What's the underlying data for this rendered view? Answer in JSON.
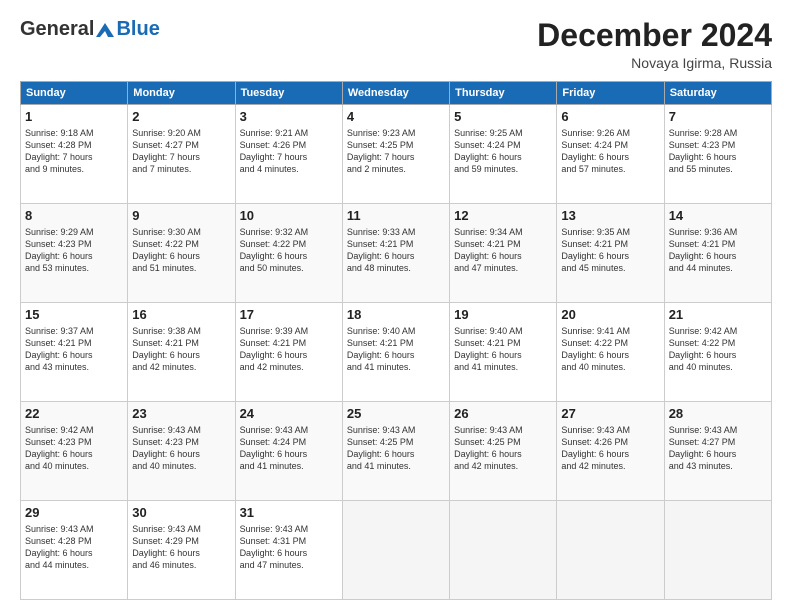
{
  "header": {
    "logo_general": "General",
    "logo_blue": "Blue",
    "month_title": "December 2024",
    "subtitle": "Novaya Igirma, Russia"
  },
  "days_of_week": [
    "Sunday",
    "Monday",
    "Tuesday",
    "Wednesday",
    "Thursday",
    "Friday",
    "Saturday"
  ],
  "weeks": [
    [
      {
        "day": "1",
        "info": "Sunrise: 9:18 AM\nSunset: 4:28 PM\nDaylight: 7 hours\nand 9 minutes."
      },
      {
        "day": "2",
        "info": "Sunrise: 9:20 AM\nSunset: 4:27 PM\nDaylight: 7 hours\nand 7 minutes."
      },
      {
        "day": "3",
        "info": "Sunrise: 9:21 AM\nSunset: 4:26 PM\nDaylight: 7 hours\nand 4 minutes."
      },
      {
        "day": "4",
        "info": "Sunrise: 9:23 AM\nSunset: 4:25 PM\nDaylight: 7 hours\nand 2 minutes."
      },
      {
        "day": "5",
        "info": "Sunrise: 9:25 AM\nSunset: 4:24 PM\nDaylight: 6 hours\nand 59 minutes."
      },
      {
        "day": "6",
        "info": "Sunrise: 9:26 AM\nSunset: 4:24 PM\nDaylight: 6 hours\nand 57 minutes."
      },
      {
        "day": "7",
        "info": "Sunrise: 9:28 AM\nSunset: 4:23 PM\nDaylight: 6 hours\nand 55 minutes."
      }
    ],
    [
      {
        "day": "8",
        "info": "Sunrise: 9:29 AM\nSunset: 4:23 PM\nDaylight: 6 hours\nand 53 minutes."
      },
      {
        "day": "9",
        "info": "Sunrise: 9:30 AM\nSunset: 4:22 PM\nDaylight: 6 hours\nand 51 minutes."
      },
      {
        "day": "10",
        "info": "Sunrise: 9:32 AM\nSunset: 4:22 PM\nDaylight: 6 hours\nand 50 minutes."
      },
      {
        "day": "11",
        "info": "Sunrise: 9:33 AM\nSunset: 4:21 PM\nDaylight: 6 hours\nand 48 minutes."
      },
      {
        "day": "12",
        "info": "Sunrise: 9:34 AM\nSunset: 4:21 PM\nDaylight: 6 hours\nand 47 minutes."
      },
      {
        "day": "13",
        "info": "Sunrise: 9:35 AM\nSunset: 4:21 PM\nDaylight: 6 hours\nand 45 minutes."
      },
      {
        "day": "14",
        "info": "Sunrise: 9:36 AM\nSunset: 4:21 PM\nDaylight: 6 hours\nand 44 minutes."
      }
    ],
    [
      {
        "day": "15",
        "info": "Sunrise: 9:37 AM\nSunset: 4:21 PM\nDaylight: 6 hours\nand 43 minutes."
      },
      {
        "day": "16",
        "info": "Sunrise: 9:38 AM\nSunset: 4:21 PM\nDaylight: 6 hours\nand 42 minutes."
      },
      {
        "day": "17",
        "info": "Sunrise: 9:39 AM\nSunset: 4:21 PM\nDaylight: 6 hours\nand 42 minutes."
      },
      {
        "day": "18",
        "info": "Sunrise: 9:40 AM\nSunset: 4:21 PM\nDaylight: 6 hours\nand 41 minutes."
      },
      {
        "day": "19",
        "info": "Sunrise: 9:40 AM\nSunset: 4:21 PM\nDaylight: 6 hours\nand 41 minutes."
      },
      {
        "day": "20",
        "info": "Sunrise: 9:41 AM\nSunset: 4:22 PM\nDaylight: 6 hours\nand 40 minutes."
      },
      {
        "day": "21",
        "info": "Sunrise: 9:42 AM\nSunset: 4:22 PM\nDaylight: 6 hours\nand 40 minutes."
      }
    ],
    [
      {
        "day": "22",
        "info": "Sunrise: 9:42 AM\nSunset: 4:23 PM\nDaylight: 6 hours\nand 40 minutes."
      },
      {
        "day": "23",
        "info": "Sunrise: 9:43 AM\nSunset: 4:23 PM\nDaylight: 6 hours\nand 40 minutes."
      },
      {
        "day": "24",
        "info": "Sunrise: 9:43 AM\nSunset: 4:24 PM\nDaylight: 6 hours\nand 41 minutes."
      },
      {
        "day": "25",
        "info": "Sunrise: 9:43 AM\nSunset: 4:25 PM\nDaylight: 6 hours\nand 41 minutes."
      },
      {
        "day": "26",
        "info": "Sunrise: 9:43 AM\nSunset: 4:25 PM\nDaylight: 6 hours\nand 42 minutes."
      },
      {
        "day": "27",
        "info": "Sunrise: 9:43 AM\nSunset: 4:26 PM\nDaylight: 6 hours\nand 42 minutes."
      },
      {
        "day": "28",
        "info": "Sunrise: 9:43 AM\nSunset: 4:27 PM\nDaylight: 6 hours\nand 43 minutes."
      }
    ],
    [
      {
        "day": "29",
        "info": "Sunrise: 9:43 AM\nSunset: 4:28 PM\nDaylight: 6 hours\nand 44 minutes."
      },
      {
        "day": "30",
        "info": "Sunrise: 9:43 AM\nSunset: 4:29 PM\nDaylight: 6 hours\nand 46 minutes."
      },
      {
        "day": "31",
        "info": "Sunrise: 9:43 AM\nSunset: 4:31 PM\nDaylight: 6 hours\nand 47 minutes."
      },
      {
        "day": "",
        "info": ""
      },
      {
        "day": "",
        "info": ""
      },
      {
        "day": "",
        "info": ""
      },
      {
        "day": "",
        "info": ""
      }
    ]
  ]
}
